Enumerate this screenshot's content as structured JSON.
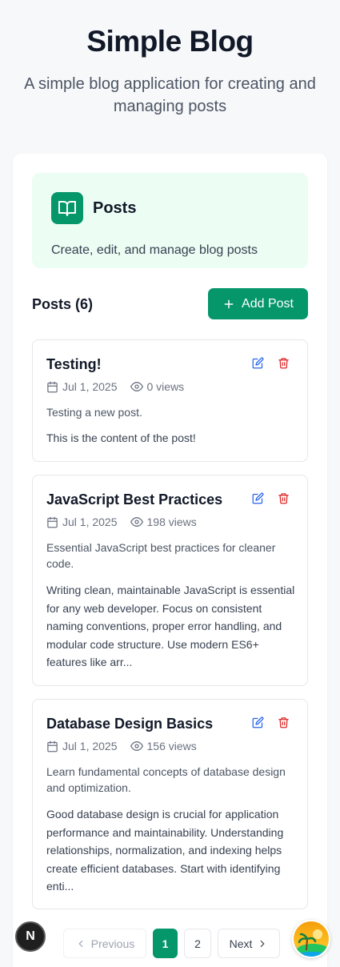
{
  "header": {
    "title": "Simple Blog",
    "subtitle": "A simple blog application for creating and managing posts"
  },
  "banner": {
    "icon": "book-open-icon",
    "title": "Posts",
    "description": "Create, edit, and manage blog posts"
  },
  "list": {
    "count_label": "Posts (6)",
    "add_label": "Add Post"
  },
  "posts": [
    {
      "title": "Testing!",
      "date": "Jul 1, 2025",
      "views": "0 views",
      "excerpt": "Testing a new post.",
      "content": "This is the content of the post!"
    },
    {
      "title": "JavaScript Best Practices",
      "date": "Jul 1, 2025",
      "views": "198 views",
      "excerpt": "Essential JavaScript best practices for cleaner code.",
      "content": "Writing clean, maintainable JavaScript is essential for any web developer. Focus on consistent naming conventions, proper error handling, and modular code structure. Use modern ES6+ features like arr..."
    },
    {
      "title": "Database Design Basics",
      "date": "Jul 1, 2025",
      "views": "156 views",
      "excerpt": "Learn fundamental concepts of database design and optimization.",
      "content": "Good database design is crucial for application performance and maintainability. Understanding relationships, normalization, and indexing helps create efficient databases. Start with identifying enti..."
    }
  ],
  "pagination": {
    "previous": "Previous",
    "pages": [
      "1",
      "2"
    ],
    "current": "1",
    "next": "Next"
  },
  "dev_badge": "N",
  "colors": {
    "accent": "#059669",
    "banner_bg": "#ecfdf3",
    "edit": "#2563eb",
    "delete": "#dc2626"
  }
}
